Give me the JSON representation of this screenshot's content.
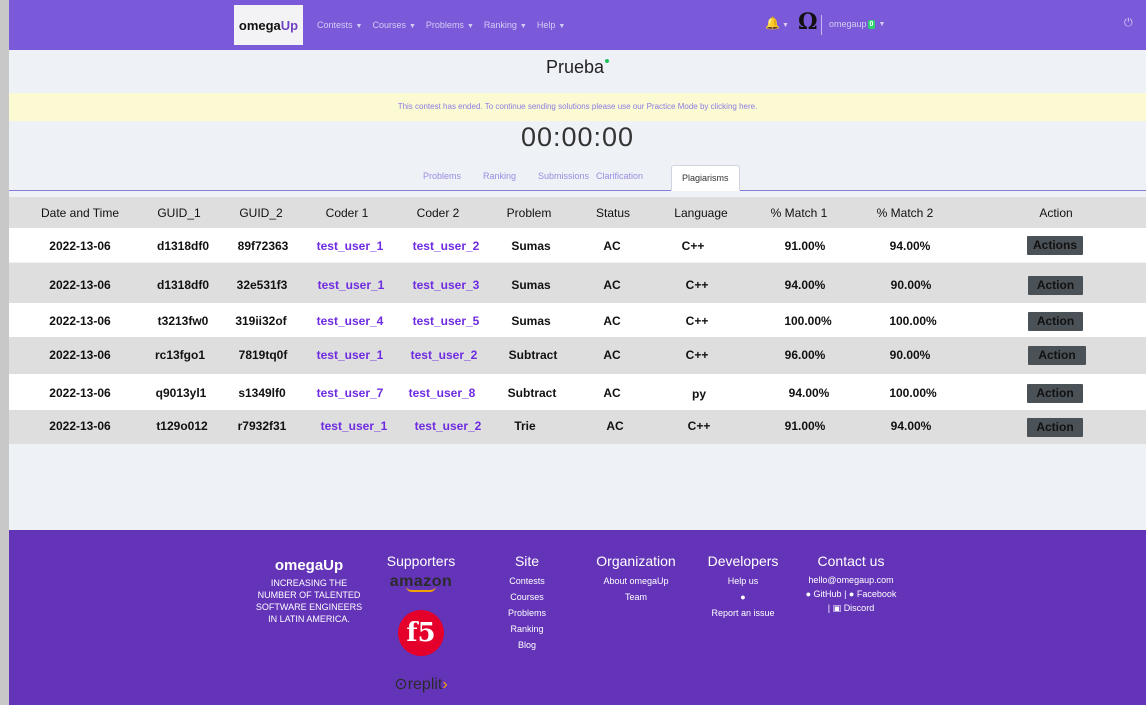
{
  "navbar": {
    "brand_prefix": "omega",
    "brand_suffix": "Up",
    "menu": [
      {
        "label": "Contests"
      },
      {
        "label": "Courses"
      },
      {
        "label": "Problems"
      },
      {
        "label": "Ranking"
      },
      {
        "label": "Help"
      }
    ],
    "omega_symbol": "Ω",
    "username": "omegaup",
    "notification_count": "0"
  },
  "contest": {
    "title": "Prueba",
    "alert": "This contest has ended. To continue sending solutions please use our Practice Mode by clicking here.",
    "timer": "00:00:00"
  },
  "tabs": [
    {
      "label": "Problems"
    },
    {
      "label": "Ranking"
    },
    {
      "label": "Submissions"
    },
    {
      "label": "Clarification"
    },
    {
      "label": "Plagiarisms",
      "active": true
    }
  ],
  "table": {
    "headers": [
      "Date and Time",
      "GUID_1",
      "GUID_2",
      "Coder 1",
      "Coder 2",
      "Problem",
      "Status",
      "Language",
      "% Match 1",
      "% Match 2",
      "Action"
    ],
    "rows": [
      {
        "date": "2022-13-06",
        "guid1": "d1318df0",
        "guid2": "89f72363",
        "coder1": "test_user_1",
        "coder2": "test_user_2",
        "problem": "Sumas",
        "status": "AC",
        "language": "C++",
        "match1": "91.00%",
        "match2": "94.00%",
        "action": "Actions"
      },
      {
        "date": "2022-13-06",
        "guid1": "d1318df0",
        "guid2": "32e531f3",
        "coder1": "test_user_1",
        "coder2": "test_user_3",
        "problem": "Sumas",
        "status": "AC",
        "language": "C++",
        "match1": "94.00%",
        "match2": "90.00%",
        "action": "Action"
      },
      {
        "date": "2022-13-06",
        "guid1": "t3213fw0",
        "guid2": "319ii32of",
        "coder1": "test_user_4",
        "coder2": "test_user_5",
        "problem": "Sumas",
        "status": "AC",
        "language": "C++",
        "match1": "100.00%",
        "match2": "100.00%",
        "action": "Action"
      },
      {
        "date": "2022-13-06",
        "guid1": "rc13fgo1",
        "guid2": "7819tq0f",
        "coder1": "test_user_1",
        "coder2": "test_user_2",
        "problem": "Subtract",
        "status": "AC",
        "language": "C++",
        "match1": "96.00%",
        "match2": "90.00%",
        "action": "Action"
      },
      {
        "date": "2022-13-06",
        "guid1": "q9013yl1",
        "guid2": "s1349lf0",
        "coder1": "test_user_7",
        "coder2": "test_user_8",
        "problem": "Subtract",
        "status": "AC",
        "language": "py",
        "match1": "94.00%",
        "match2": "100.00%",
        "action": "Action"
      },
      {
        "date": "2022-13-06",
        "guid1": "t129o012",
        "guid2": "r7932f31",
        "coder1": "test_user_1",
        "coder2": "test_user_2",
        "problem": "Trie",
        "status": "AC",
        "language": "C++",
        "match1": "91.00%",
        "match2": "94.00%",
        "action": "Action"
      }
    ]
  },
  "footer": {
    "brand": "omegaUp",
    "tagline": [
      "INCREASING THE",
      "NUMBER OF TALENTED",
      "SOFTWARE ENGINEERS",
      "IN LATIN AMERICA."
    ],
    "supporters_title": "Supporters",
    "supporters": {
      "amazon": "amazon",
      "f5": "f5",
      "replit": "replit"
    },
    "site_title": "Site",
    "site_links": [
      "Contests",
      "Courses",
      "Problems",
      "Ranking",
      "Blog"
    ],
    "org_title": "Organization",
    "org_links": [
      "About omegaUp",
      "Team"
    ],
    "dev_title": "Developers",
    "dev_links": [
      "Help us",
      "Report an issue"
    ],
    "contact_title": "Contact us",
    "contact_email": "hello@omegaup.com",
    "contact_github": "GitHub",
    "contact_sep": "|",
    "contact_facebook": "Facebook",
    "contact_discord": "Discord"
  }
}
